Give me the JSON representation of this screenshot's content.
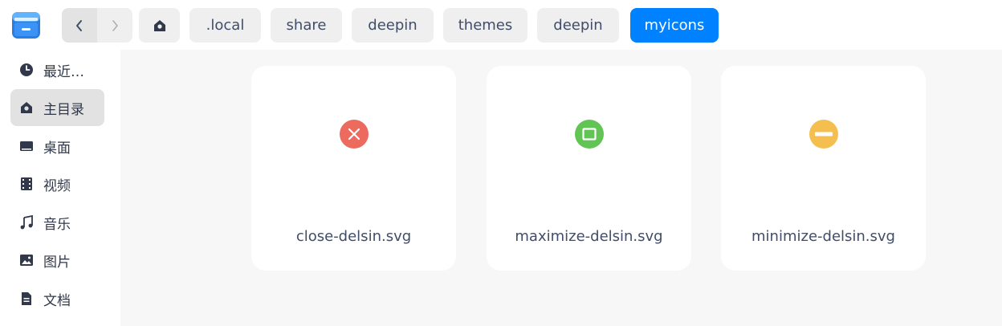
{
  "toolbar": {
    "app_icon": "file-manager-icon",
    "back_icon": "chevron-left-icon",
    "forward_icon": "chevron-right-icon",
    "home_icon": "home-icon",
    "breadcrumbs": [
      ".local",
      "share",
      "deepin",
      "themes",
      "deepin",
      "myicons"
    ],
    "active_crumb": "myicons"
  },
  "sidebar": {
    "items": [
      {
        "label": "最近…",
        "icon": "clock-icon"
      },
      {
        "label": "主目录",
        "icon": "home-icon"
      },
      {
        "label": "桌面",
        "icon": "desktop-icon"
      },
      {
        "label": "视频",
        "icon": "film-icon"
      },
      {
        "label": "音乐",
        "icon": "music-icon"
      },
      {
        "label": "图片",
        "icon": "image-icon"
      },
      {
        "label": "文档",
        "icon": "document-icon"
      }
    ],
    "selected": "主目录"
  },
  "files": [
    {
      "name": "close-delsin.svg",
      "icon": "close-delsin-icon",
      "color": "#ec6a5e"
    },
    {
      "name": "maximize-delsin.svg",
      "icon": "maximize-delsin-icon",
      "color": "#61c454"
    },
    {
      "name": "minimize-delsin.svg",
      "icon": "minimize-delsin-icon",
      "color": "#f4bf4f"
    }
  ],
  "colors": {
    "accent": "#0081ff",
    "sidebar_selected": "#e2e2e2",
    "content_bg": "#f7f7f7"
  }
}
